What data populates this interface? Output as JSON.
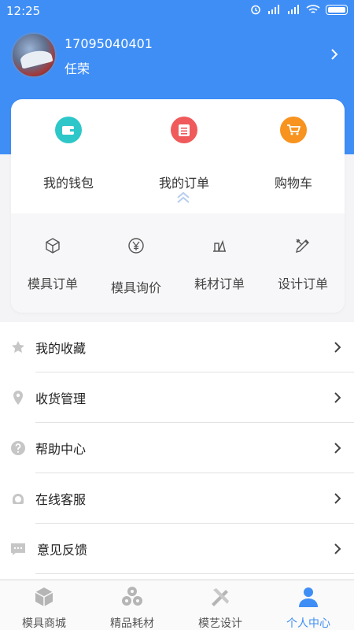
{
  "status_bar": {
    "time": "12:25"
  },
  "profile": {
    "phone": "17095040401",
    "name": "任荣"
  },
  "quick_actions": [
    {
      "label": "我的钱包",
      "icon": "wallet-icon",
      "color": "#2ec7c9"
    },
    {
      "label": "我的订单",
      "icon": "order-list-icon",
      "color": "#f05a5a"
    },
    {
      "label": "购物车",
      "icon": "cart-icon",
      "color": "#f7931e"
    }
  ],
  "order_types": [
    {
      "label": "模具订单",
      "icon": "cube-icon"
    },
    {
      "label": "模具询价",
      "icon": "yen-icon"
    },
    {
      "label": "耗材订单",
      "icon": "material-icon"
    },
    {
      "label": "设计订单",
      "icon": "pencil-ruler-icon"
    }
  ],
  "menu": [
    {
      "label": "我的收藏",
      "icon": "star-icon"
    },
    {
      "label": "收货管理",
      "icon": "location-pin-icon"
    },
    {
      "label": "帮助中心",
      "icon": "help-icon"
    },
    {
      "label": "在线客服",
      "icon": "headset-icon"
    },
    {
      "label": "意见反馈",
      "icon": "feedback-icon"
    }
  ],
  "tabs": [
    {
      "label": "模具商城",
      "icon": "box-icon"
    },
    {
      "label": "精品耗材",
      "icon": "spools-icon"
    },
    {
      "label": "模艺设计",
      "icon": "design-icon"
    },
    {
      "label": "个人中心",
      "icon": "user-icon"
    }
  ],
  "colors": {
    "primary": "#3f8ef6",
    "wallet": "#2ec7c9",
    "orders": "#f05a5a",
    "cart": "#f7931e",
    "tab_inactive": "#b5b5b5"
  }
}
